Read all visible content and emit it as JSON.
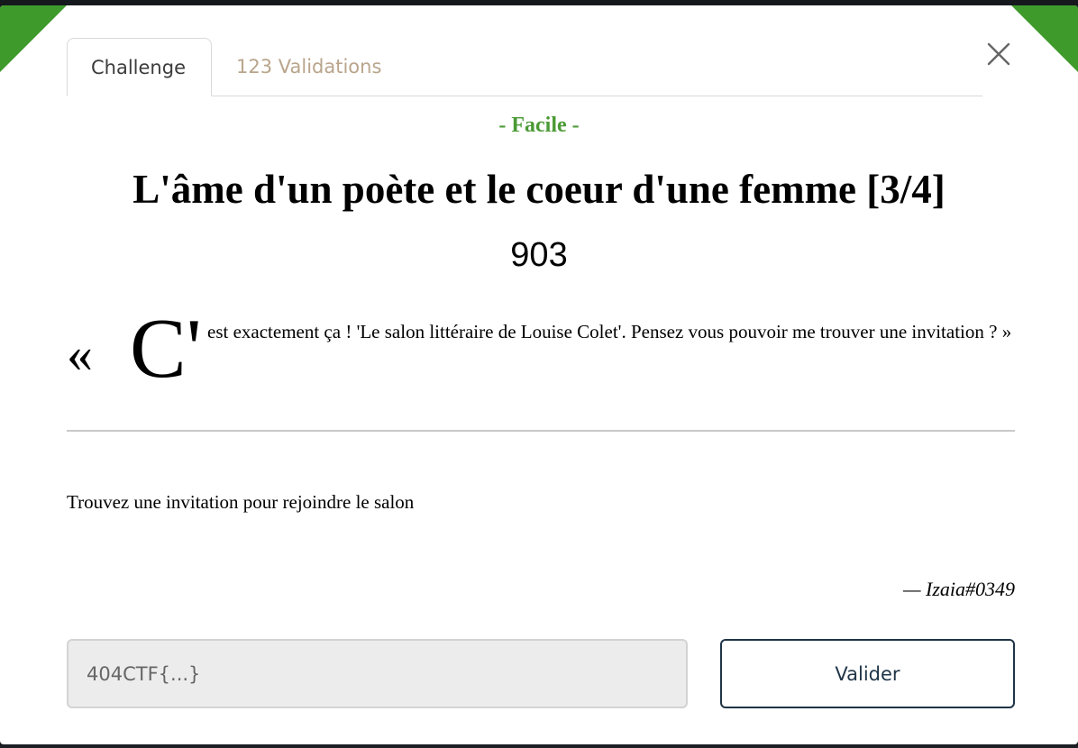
{
  "tabs": [
    {
      "label": "Challenge",
      "active": true
    },
    {
      "label": "123 Validations",
      "active": false
    }
  ],
  "challenge": {
    "difficulty": "- Facile -",
    "title": "L'âme d'un poète et le coeur d'une femme [3/4]",
    "points": "903",
    "quote": {
      "open_mark": "«",
      "dropcap": "C'",
      "text": "est exactement ça ! 'Le salon littéraire de Louise Colet'. Pensez vous pouvoir me trouver une invitation ? »"
    },
    "instruction": "Trouvez une invitation pour rejoindre le salon",
    "author": "— Izaia#0349"
  },
  "form": {
    "flag_placeholder": "404CTF{...}",
    "flag_value": "",
    "submit_label": "Valider"
  },
  "colors": {
    "accent_green": "#3e9a2b",
    "difficulty_green": "#4b9a35",
    "inactive_tab": "#b9a58c",
    "button_border": "#1f3447"
  },
  "icons": {
    "close": "close-icon"
  }
}
